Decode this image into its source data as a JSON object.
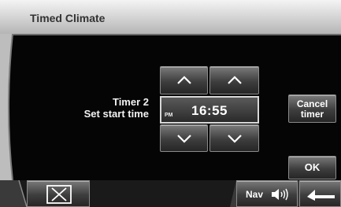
{
  "header": {
    "title": "Timed Climate"
  },
  "timer": {
    "name": "Timer 2",
    "instruction": "Set start time",
    "ampm": "PM",
    "time": "16:55"
  },
  "buttons": {
    "cancel_line1": "Cancel",
    "cancel_line2": "timer",
    "ok": "OK",
    "nav": "Nav"
  },
  "icons": {
    "close": "close-x-icon",
    "speaker": "speaker-volume-icon",
    "back": "back-arrow-icon",
    "up": "chevron-up-icon",
    "down": "chevron-down-icon"
  }
}
